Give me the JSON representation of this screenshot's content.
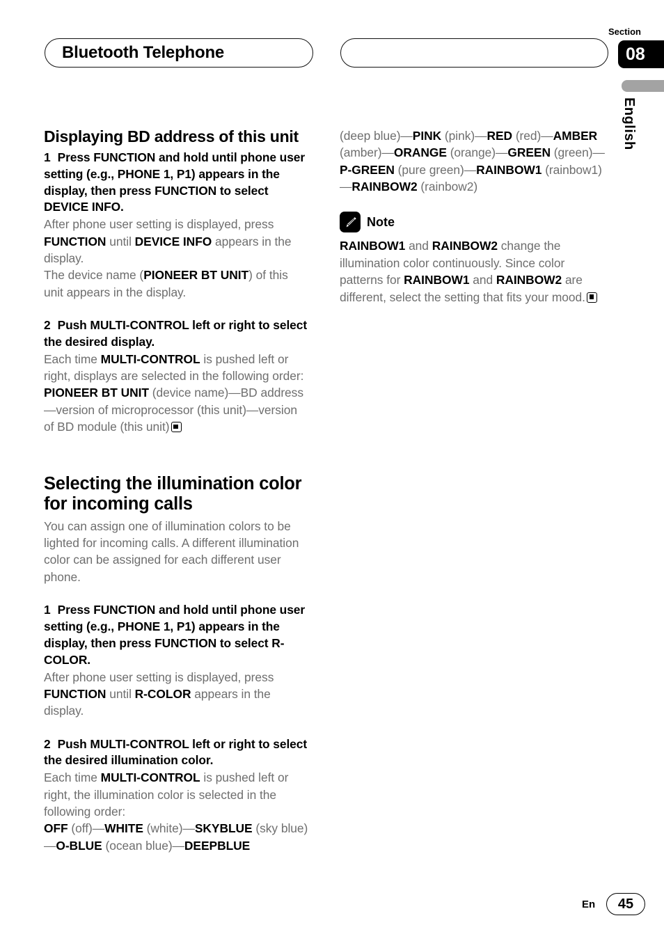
{
  "header": {
    "title": "Bluetooth Telephone",
    "section_label": "Section",
    "section_number": "08",
    "language_tab": "English"
  },
  "left_column": {
    "heading_1": "Displaying BD address of this unit",
    "step_1": {
      "number": "1",
      "text": "Press FUNCTION and hold until phone user setting (e.g., PHONE 1, P1) appears in the display, then press FUNCTION to select DEVICE INFO."
    },
    "step_1_body_a_pre": "After phone user setting is displayed, press ",
    "step_1_body_a_b1": "FUNCTION",
    "step_1_body_a_mid": " until ",
    "step_1_body_a_b2": "DEVICE INFO",
    "step_1_body_a_post": " appears in the display.",
    "step_1_body_b_pre": "The device name (",
    "step_1_body_b_b1": "PIONEER BT UNIT",
    "step_1_body_b_post": ") of this unit appears in the display.",
    "step_2": {
      "number": "2",
      "text": "Push MULTI-CONTROL left or right to select the desired display."
    },
    "step_2_body_pre": "Each time ",
    "step_2_body_b1": "MULTI-CONTROL",
    "step_2_body_post": " is pushed left or right, displays are selected in the following order:",
    "order_b1": "PIONEER BT UNIT",
    "order_rest": " (device name)—BD address—version of microprocessor (this unit)—version of BD module (this unit)",
    "heading_2": "Selecting the illumination color for incoming calls",
    "intro": "You can assign one of illumination colors to be lighted for incoming calls. A different illumination color can be assigned for each different user phone.",
    "step_3": {
      "number": "1",
      "text": "Press FUNCTION and hold until phone user setting (e.g., PHONE 1, P1) appears in the display, then press FUNCTION to select R-COLOR."
    },
    "step_3_body_pre": "After phone user setting is displayed, press ",
    "step_3_body_b1": "FUNCTION",
    "step_3_body_mid": " until ",
    "step_3_body_b2": "R-COLOR",
    "step_3_body_post": " appears in the display.",
    "step_4": {
      "number": "2",
      "text": "Push MULTI-CONTROL left or right to select the desired illumination color."
    },
    "step_4_body_pre": "Each time ",
    "step_4_body_b1": "MULTI-CONTROL",
    "step_4_body_post": " is pushed left or right, the illumination color is selected in the following order:",
    "colors": {
      "c1_name": "OFF",
      "c1_desc": " (off)—",
      "c2_name": "WHITE",
      "c2_desc": " (white)—",
      "c3_name": "SKYBLUE",
      "c3_desc": " (sky blue)—",
      "c4_name": "O-BLUE",
      "c4_desc": " (ocean blue)—",
      "c5_name": "DEEPBLUE"
    }
  },
  "right_column": {
    "colors_cont": {
      "c5_desc": " (deep blue)—",
      "c6_name": "PINK",
      "c6_desc": " (pink)—",
      "c7_name": "RED",
      "c7_desc": " (red)—",
      "c8_name": "AMBER",
      "c8_desc": " (amber)—",
      "c9_name": "ORANGE",
      "c9_desc": " (orange)—",
      "c10_name": "GREEN",
      "c10_desc": " (green)—",
      "c11_name": "P-GREEN",
      "c11_desc": " (pure green)—",
      "c12_name": "RAINBOW1",
      "c12_desc": " (rainbow1)—",
      "c13_name": "RAINBOW2",
      "c13_desc": " (rainbow2)"
    },
    "note": {
      "label": "Note",
      "icon": "pencil-icon",
      "b1": "RAINBOW1",
      "t1": " and ",
      "b2": "RAINBOW2",
      "t2": " change the illumination color continuously. Since color patterns for ",
      "b3": "RAINBOW1",
      "t3": " and ",
      "b4": "RAINBOW2",
      "t4": " are different, select the setting that fits your mood."
    }
  },
  "footer": {
    "language": "En",
    "page_number": "45"
  },
  "colors": {
    "text_body": "#6e6e6e",
    "text_bold": "#000000",
    "tab_background": "#000000",
    "language_bar": "#a3a3a3",
    "page_background": "#ffffff"
  }
}
